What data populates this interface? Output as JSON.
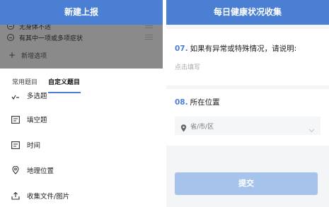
{
  "left_panel": {
    "header_title": "新建上报",
    "options": [
      {
        "label": "无身体不适"
      },
      {
        "label": "有其中一项或多项症状"
      }
    ],
    "add_option_label": "新增选项",
    "tabs": [
      {
        "label": "常用题目",
        "active": false
      },
      {
        "label": "自定义题目",
        "active": true
      }
    ],
    "partial_item_label": "多选题",
    "items": [
      {
        "label": "填空题",
        "icon": "text-box-icon"
      },
      {
        "label": "时间",
        "icon": "time-box-icon"
      },
      {
        "label": "地理位置",
        "icon": "location-icon"
      },
      {
        "label": "收集文件/图片",
        "icon": "upload-icon"
      }
    ]
  },
  "right_panel": {
    "header_title": "每日健康状况收集",
    "q7": {
      "number": "07.",
      "text": "如果有异常或特殊情况，请说明:",
      "placeholder": "点击填写"
    },
    "q8": {
      "number": "08.",
      "text": "所在位置",
      "select_value": "省/市/区"
    },
    "submit_label": "提交"
  },
  "colors": {
    "accent": "#4a7fd3",
    "submit_disabled": "#a6c3ec",
    "overlay_dim": "#8a8a8a"
  }
}
